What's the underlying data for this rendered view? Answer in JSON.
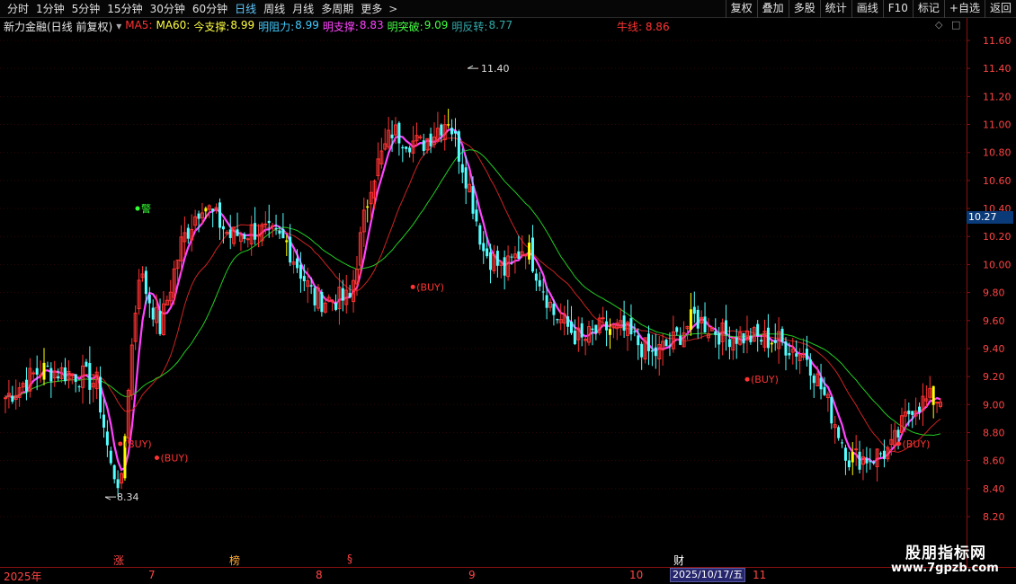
{
  "toolbar": {
    "tabs": [
      "分时",
      "1分钟",
      "5分钟",
      "15分钟",
      "30分钟",
      "60分钟",
      "日线",
      "周线",
      "月线",
      "多周期",
      "更多"
    ],
    "active_tab": "日线",
    "more_arrow": ">",
    "right_buttons": [
      "复权",
      "叠加",
      "多股",
      "统计",
      "画线",
      "F10",
      "标记",
      "+自选",
      "返回"
    ]
  },
  "legend": {
    "title": "新力金融(日线 前复权)",
    "dropdown_icon": "chevron-down-icon",
    "items": [
      {
        "label": "MA5:",
        "value": "",
        "color": "#ff3333"
      },
      {
        "label": "MA60:",
        "value": "",
        "color": "#ffff44"
      },
      {
        "label": "今支撑:",
        "value": "8.99",
        "color": "#ffff44"
      },
      {
        "label": "明阻力:",
        "value": "8.99",
        "color": "#44ccff"
      },
      {
        "label": "明支撑:",
        "value": "8.83",
        "color": "#ff44ff"
      },
      {
        "label": "明突破:",
        "value": "9.09",
        "color": "#44ff44"
      },
      {
        "label": "明反转:",
        "value": "8.77",
        "color": "#33aaaa"
      }
    ],
    "bull_line": "牛线: 8.86"
  },
  "chart_data": {
    "type": "candlestick",
    "y_ticks": [
      "11.60",
      "11.40",
      "11.20",
      "11.00",
      "10.80",
      "10.60",
      "10.40",
      "10.20",
      "10.00",
      "9.80",
      "9.60",
      "9.40",
      "9.20",
      "9.00",
      "8.80",
      "8.60",
      "8.40",
      "8.20"
    ],
    "ylim": [
      8.1,
      11.7
    ],
    "current_price": "10.27",
    "high_label": "11.40",
    "low_label": "8.34",
    "warning_label": "警",
    "buy_label": "(BUY)",
    "buy_signals": [
      {
        "date": "2025-06-24",
        "price": 8.72
      },
      {
        "date": "2025-07-01",
        "price": 8.62
      },
      {
        "date": "2025-08-19",
        "price": 9.84
      },
      {
        "date": "2025-10-22",
        "price": 9.18
      },
      {
        "date": "2025-11-20",
        "price": 8.72
      }
    ],
    "months": [
      "7",
      "8",
      "9",
      "10",
      "11"
    ],
    "year": "2025年",
    "selected_date": "2025/10/17/五",
    "events": [
      {
        "label": "涨",
        "color": "#ff4444"
      },
      {
        "label": "榜",
        "color": "#ffaa33"
      },
      {
        "label": "§",
        "color": "#ff4444"
      },
      {
        "label": "财",
        "color": "#ffffff"
      }
    ]
  },
  "colors": {
    "up": "#ff3232",
    "down": "#54ffff",
    "ma_fast": "#ff44ff",
    "ma_mid": "#cc2222",
    "ma_slow": "#22cc22",
    "highlight": "#ffff00",
    "background": "#000000",
    "grid": "#8a1010"
  },
  "watermark": {
    "title": "股朋指标网",
    "url": "www.7gpzb.com"
  }
}
